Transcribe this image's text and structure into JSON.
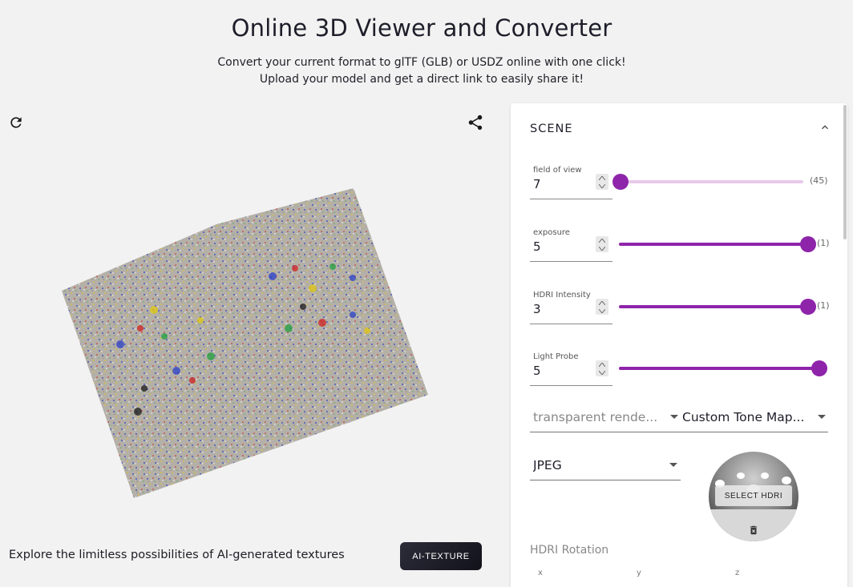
{
  "header": {
    "title": "Online 3D Viewer and Converter",
    "subtitle_line1": "Convert your current format to glTF (GLB) or USDZ online with one click!",
    "subtitle_line2": "Upload your model and get a direct link to easily share it!"
  },
  "icons": {
    "refresh": "refresh-icon",
    "share": "share-icon",
    "collapse": "chevron-up-icon",
    "dropdown": "caret-down-icon",
    "trash": "delete-icon"
  },
  "promo": {
    "text": "Explore the limitless possibilities of AI-generated textures",
    "button_label": "AI-TEXTURE"
  },
  "scene": {
    "title": "SCENE",
    "controls": [
      {
        "label": "field of view",
        "value": "7",
        "tag": "(45)",
        "slider_fraction": 0.0
      },
      {
        "label": "exposure",
        "value": "5",
        "tag": "(1)",
        "slider_fraction": 1.0
      },
      {
        "label": "HDRI Intensity",
        "value": "3",
        "tag": "(1)",
        "slider_fraction": 1.0
      },
      {
        "label": "Light Probe",
        "value": "5",
        "tag": "",
        "slider_fraction": 1.0
      }
    ],
    "transparent_select": "transparent rende...",
    "tone_mapping_select": "Custom Tone Map...",
    "format_select": "JPEG",
    "hdri_button": "SELECT HDRI",
    "hdri_rotation_label": "HDRI Rotation",
    "axes": [
      "x",
      "y",
      "z"
    ]
  },
  "colors": {
    "accent": "#8e24aa",
    "accent_light": "#e6c9ea",
    "background": "#f2f2f2",
    "panel": "#ffffff",
    "ai_button": "#1a1a24"
  }
}
